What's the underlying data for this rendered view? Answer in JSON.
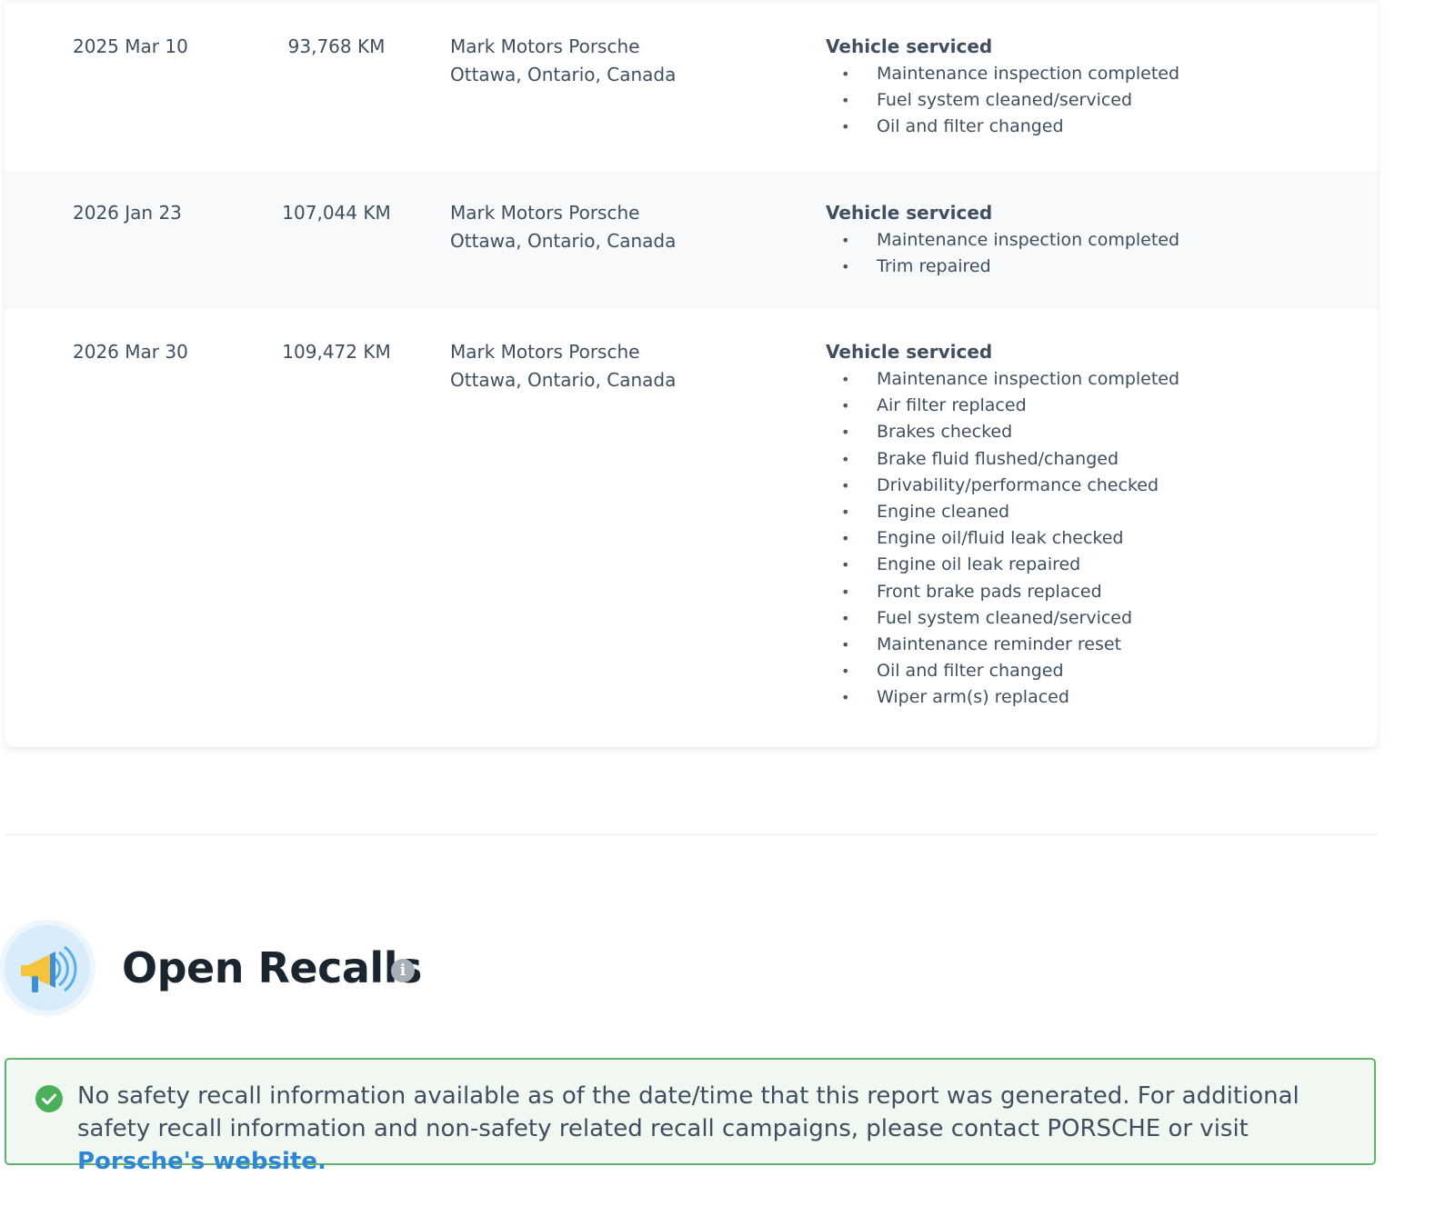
{
  "service_records": [
    {
      "date": "2025 Mar 10",
      "odometer": "93,768 KM",
      "source_name": "Mark Motors Porsche",
      "source_location": "Ottawa, Ontario, Canada",
      "details_title": "Vehicle serviced",
      "details": [
        "Maintenance inspection completed",
        "Fuel system cleaned/serviced",
        "Oil and filter changed"
      ]
    },
    {
      "date": "2026 Jan 23",
      "odometer": "107,044 KM",
      "source_name": "Mark Motors Porsche",
      "source_location": "Ottawa, Ontario, Canada",
      "details_title": "Vehicle serviced",
      "details": [
        "Maintenance inspection completed",
        "Trim repaired"
      ]
    },
    {
      "date": "2026 Mar 30",
      "odometer": "109,472 KM",
      "source_name": "Mark Motors Porsche",
      "source_location": "Ottawa, Ontario, Canada",
      "details_title": "Vehicle serviced",
      "details": [
        "Maintenance inspection completed",
        "Air filter replaced",
        "Brakes checked",
        "Brake fluid flushed/changed",
        "Drivability/performance checked",
        "Engine cleaned",
        "Engine oil/fluid leak checked",
        "Engine oil leak repaired",
        "Front brake pads replaced",
        "Fuel system cleaned/serviced",
        "Maintenance reminder reset",
        "Oil and filter changed",
        "Wiper arm(s) replaced"
      ]
    }
  ],
  "recalls": {
    "title": "Open Recalls",
    "icon": "megaphone-icon",
    "info_icon": "info-icon",
    "info_glyph": "i",
    "notice_text": "No safety recall information available as of the date/time that this report was generated. For additional safety recall information and non-safety related recall campaigns, please contact PORSCHE or visit ",
    "notice_link_text": "Porsche's website.",
    "notice_icon": "check-circle-icon"
  },
  "colors": {
    "text": "#3f4f5f",
    "title": "#1b2530",
    "link": "#2f86d6",
    "success_border": "#5fb46e",
    "success_bg": "#f1f8f2",
    "alt_row_bg": "#f7f9fb"
  }
}
